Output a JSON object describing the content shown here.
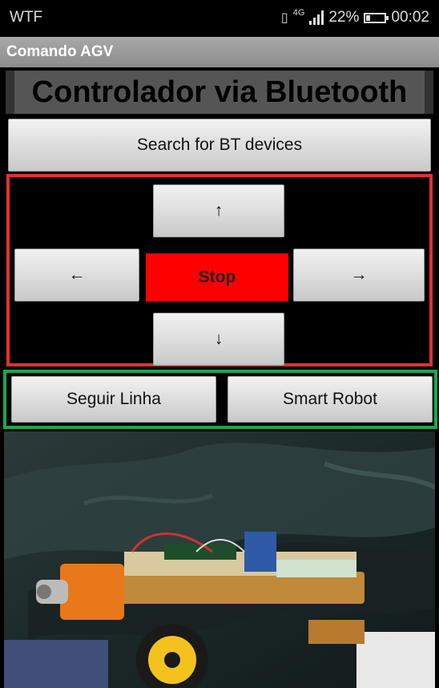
{
  "status_bar": {
    "carrier": "WTF",
    "network": "4G",
    "battery_percent": "22%",
    "battery_level": 0.22,
    "time": "00:02"
  },
  "app_bar": {
    "title": "Comando AGV"
  },
  "main": {
    "heading": "Controlador via Bluetooth",
    "search_button": "Search for BT devices",
    "dpad": {
      "up": "↑",
      "left": "←",
      "stop": "Stop",
      "right": "→",
      "down": "↓"
    },
    "modes": {
      "follow_line": "Seguir Linha",
      "smart_robot": "Smart Robot"
    }
  },
  "colors": {
    "dpad_border": "#e53030",
    "stop_button": "#ff0000",
    "modes_border": "#1aa84a"
  },
  "image": {
    "subject": "robot-car-photo"
  }
}
